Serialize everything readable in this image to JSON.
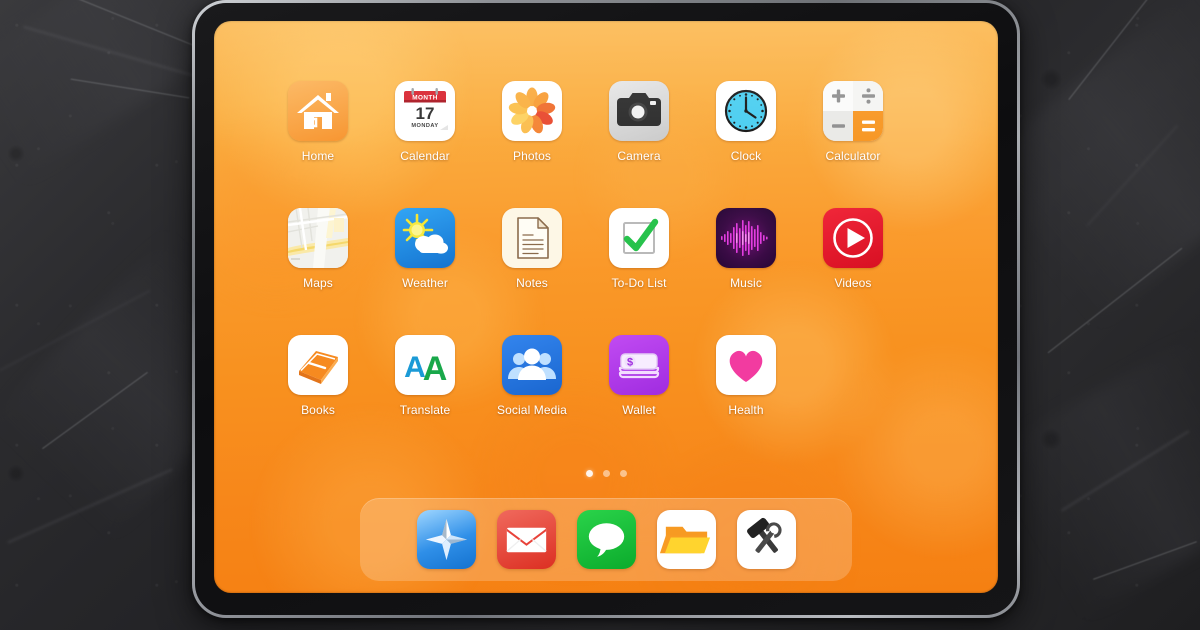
{
  "device": {
    "type": "tablet",
    "orientation": "landscape"
  },
  "wallpaper": {
    "style": "orange-bokeh-gradient",
    "top_color": "#fcb546",
    "bottom_color": "#f58012"
  },
  "backdrop": {
    "style": "dark-slate-stone",
    "color": "#262628"
  },
  "home_screen": {
    "rows": [
      [
        {
          "label": "Home",
          "icon": "house-icon",
          "bg": "#f9a23c"
        },
        {
          "label": "Calendar",
          "icon": "calendar-icon",
          "bg": "#ffffff",
          "day": "17",
          "weekday": "MONDAY",
          "month": "MONTH"
        },
        {
          "label": "Photos",
          "icon": "flower-icon",
          "bg": "#ffffff"
        },
        {
          "label": "Camera",
          "icon": "camera-icon",
          "bg": "#d8d8d8"
        },
        {
          "label": "Clock",
          "icon": "clock-icon",
          "bg": "#ffffff"
        },
        {
          "label": "Calculator",
          "icon": "calculator-icon",
          "bg": "#f0f0ee"
        }
      ],
      [
        {
          "label": "Maps",
          "icon": "map-icon",
          "bg": "#eeeeea"
        },
        {
          "label": "Weather",
          "icon": "sun-cloud-icon",
          "bg": "#1e90e8"
        },
        {
          "label": "Notes",
          "icon": "document-icon",
          "bg": "#fdf6e4"
        },
        {
          "label": "To-Do List",
          "icon": "checkbox-icon",
          "bg": "#ffffff"
        },
        {
          "label": "Music",
          "icon": "waveform-icon",
          "bg": "#2a0a35"
        },
        {
          "label": "Videos",
          "icon": "play-icon",
          "bg": "#e8192c"
        }
      ],
      [
        {
          "label": "Books",
          "icon": "book-icon",
          "bg": "#ffffff"
        },
        {
          "label": "Translate",
          "icon": "double-a-icon",
          "bg": "#ffffff"
        },
        {
          "label": "Social Media",
          "icon": "people-icon",
          "bg": "#2277e0"
        },
        {
          "label": "Wallet",
          "icon": "money-icon",
          "bg": "#b23ce8"
        },
        {
          "label": "Health",
          "icon": "heart-icon",
          "bg": "#ffffff"
        }
      ]
    ]
  },
  "page_indicator": {
    "total": 3,
    "active": 1
  },
  "dock": {
    "items": [
      {
        "name": "Browser",
        "icon": "compass-icon",
        "bg": "#3ea2f0"
      },
      {
        "name": "Mail",
        "icon": "envelope-icon",
        "bg": "#e8433a"
      },
      {
        "name": "Messages",
        "icon": "chat-icon",
        "bg": "#18c13a"
      },
      {
        "name": "Files",
        "icon": "folder-icon",
        "bg": "#ffffff"
      },
      {
        "name": "Utilities",
        "icon": "tools-icon",
        "bg": "#ffffff"
      }
    ]
  }
}
